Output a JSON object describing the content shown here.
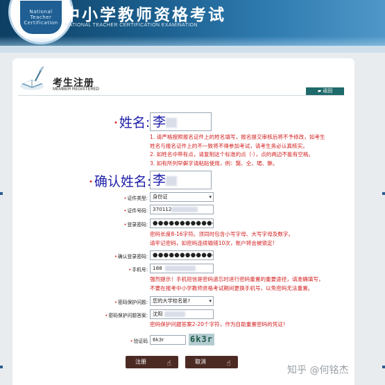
{
  "header": {
    "title": "中小学教师资格考试",
    "subtitle": "NATIONAL TEACHER CERTIFICATION EXAMINATION",
    "logo_text": "National Teacher Certification"
  },
  "page": {
    "title": "考生注册",
    "subtitle": "MEMBER REGISTERED",
    "back_label": "返回"
  },
  "form": {
    "name_label": "姓名:",
    "name_value": "李",
    "confirm_name_label": "确认姓名:",
    "confirm_name_value": "李",
    "name_notes": [
      "1. 请严格按照报名证件上的姓名填写，报名提交审核后将不予修改，如考生",
      "姓名与报名证件上的不一致将不得参加考试，请考生务必认真核实。",
      "2. 如姓名中带有点，请复制这个标准的点（·），点的两边不能有空格。",
      "3. 如有所列罕僻字请粘贴使用，例：龑、仝、珺、翀。"
    ],
    "id_type_label": "证件类型:",
    "id_type_value": "身份证",
    "id_number_label": "证件号码:",
    "id_number_value": "370112",
    "password_label": "登录密码:",
    "password_value": "●●●●●●●●●●●●●●●",
    "password_notes": [
      "密码长度8-16字符。须同时包含小写字母、大写字母及数字。",
      "请牢记密码，如密码连续输错10次，账户将会被锁定!"
    ],
    "confirm_password_label": "确认登录密码:",
    "confirm_password_value": "●●●●●●●●●●●●●●●",
    "phone_label": "手机号:",
    "phone_value": "188",
    "phone_notes": [
      "强烈提示！手机短信是密码遗忘时进行密码重置的重要途径，请准确填写，",
      "不要在报考中小学教师资格考试期间更换手机号，以免密码无法重置。"
    ],
    "question_label": "密码保护问题:",
    "question_value": "您的大学校名是?",
    "answer_label": "密码保护问题答案:",
    "answer_value": "沈阳",
    "answer_notes": "密码保护问题答案2-20个字符，作为自助重置密码的凭证!",
    "captcha_label": "验证码",
    "captcha_value": "6k3r",
    "captcha_image_text": "6k3r"
  },
  "buttons": {
    "submit": "注册",
    "cancel": "取消"
  },
  "watermark": "知乎 @何铭杰",
  "colors": {
    "banner": "#1b5f8e",
    "label_blue": "#1e1ea8",
    "warning_red": "#d21b1b",
    "button_brown": "#4c2a24",
    "back_button": "#1f6a6a"
  }
}
